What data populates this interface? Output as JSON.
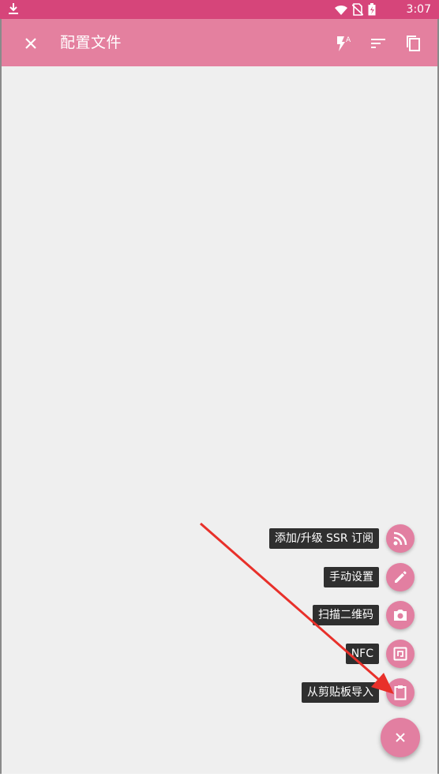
{
  "status_bar": {
    "time": "3:07",
    "battery_level": "3",
    "icons": [
      "download-icon",
      "wifi-icon",
      "no-sim-icon",
      "battery-icon"
    ]
  },
  "toolbar": {
    "title": "配置文件",
    "icons": [
      "close-icon",
      "flash-auto-icon",
      "sort-icon",
      "copy-icon"
    ]
  },
  "fab_menu": {
    "items": [
      {
        "label": "添加/升级 SSR 订阅",
        "icon": "rss-icon"
      },
      {
        "label": "手动设置",
        "icon": "edit-icon"
      },
      {
        "label": "扫描二维码",
        "icon": "camera-icon"
      },
      {
        "label": "NFC",
        "icon": "nfc-icon"
      },
      {
        "label": "从剪贴板导入",
        "icon": "clipboard-icon"
      }
    ],
    "close_icon": "close-icon"
  },
  "colors": {
    "status_bar": "#d6457a",
    "toolbar": "#e4809f",
    "accent": "#e27fa1",
    "background": "#efefef",
    "annotation_arrow": "#e8302a"
  }
}
